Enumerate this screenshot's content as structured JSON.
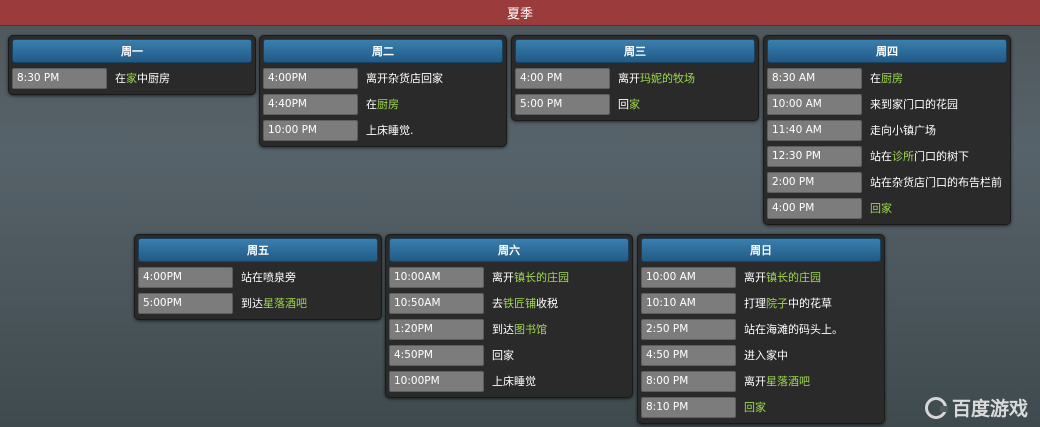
{
  "season": "夏季",
  "days": [
    {
      "title": "周一",
      "rows": [
        {
          "time": "8:30 PM",
          "parts": [
            {
              "t": "在"
            },
            {
              "t": "家",
              "g": true
            },
            {
              "t": "中厨房"
            }
          ]
        }
      ]
    },
    {
      "title": "周二",
      "rows": [
        {
          "time": "4:00PM",
          "parts": [
            {
              "t": "离开杂货店回家"
            }
          ]
        },
        {
          "time": "4:40PM",
          "parts": [
            {
              "t": "在"
            },
            {
              "t": "厨房",
              "g": true
            }
          ]
        },
        {
          "time": "10:00 PM",
          "parts": [
            {
              "t": "上床睡觉."
            }
          ]
        }
      ]
    },
    {
      "title": "周三",
      "rows": [
        {
          "time": "4:00 PM",
          "parts": [
            {
              "t": "离开"
            },
            {
              "t": "玛妮的牧场",
              "g": true
            }
          ]
        },
        {
          "time": "5:00 PM",
          "parts": [
            {
              "t": "回"
            },
            {
              "t": "家",
              "g": true
            }
          ]
        }
      ]
    },
    {
      "title": "周四",
      "rows": [
        {
          "time": "8:30 AM",
          "parts": [
            {
              "t": "在"
            },
            {
              "t": "厨房",
              "g": true
            }
          ]
        },
        {
          "time": "10:00 AM",
          "parts": [
            {
              "t": "来到家门口的花园"
            }
          ]
        },
        {
          "time": "11:40 AM",
          "parts": [
            {
              "t": "走向小镇广场"
            }
          ]
        },
        {
          "time": "12:30 PM",
          "parts": [
            {
              "t": "站在"
            },
            {
              "t": "诊所",
              "g": true
            },
            {
              "t": "门口的树下"
            }
          ]
        },
        {
          "time": "2:00 PM",
          "parts": [
            {
              "t": "站在杂货店门口的布告栏前"
            }
          ]
        },
        {
          "time": "4:00 PM",
          "parts": [
            {
              "t": "回家",
              "g": true
            }
          ]
        }
      ]
    },
    {
      "title": "周五",
      "rows": [
        {
          "time": "4:00PM",
          "parts": [
            {
              "t": "站在喷泉旁"
            }
          ]
        },
        {
          "time": "5:00PM",
          "parts": [
            {
              "t": "到达"
            },
            {
              "t": "星落酒吧",
              "g": true
            }
          ]
        }
      ]
    },
    {
      "title": "周六",
      "rows": [
        {
          "time": "10:00AM",
          "parts": [
            {
              "t": "离开"
            },
            {
              "t": "镇长的庄园",
              "g": true
            }
          ]
        },
        {
          "time": "10:50AM",
          "parts": [
            {
              "t": "去"
            },
            {
              "t": "铁匠铺",
              "g": true
            },
            {
              "t": "收税"
            }
          ]
        },
        {
          "time": "1:20PM",
          "parts": [
            {
              "t": "到达"
            },
            {
              "t": "图书馆",
              "g": true
            }
          ]
        },
        {
          "time": "4:50PM",
          "parts": [
            {
              "t": "回家"
            }
          ]
        },
        {
          "time": "10:00PM",
          "parts": [
            {
              "t": "上床睡觉"
            }
          ]
        }
      ]
    },
    {
      "title": "周日",
      "rows": [
        {
          "time": "10:00 AM",
          "parts": [
            {
              "t": "离开"
            },
            {
              "t": "镇长的庄园",
              "g": true
            }
          ]
        },
        {
          "time": "10:10 AM",
          "parts": [
            {
              "t": "打理"
            },
            {
              "t": "院子",
              "g": true
            },
            {
              "t": "中的花草"
            }
          ]
        },
        {
          "time": "2:50 PM",
          "parts": [
            {
              "t": "站在海滩的码头上。"
            }
          ]
        },
        {
          "time": "4:50 PM",
          "parts": [
            {
              "t": "进入家中"
            }
          ]
        },
        {
          "time": "8:00 PM",
          "parts": [
            {
              "t": "离开"
            },
            {
              "t": "星落酒吧",
              "g": true
            }
          ]
        },
        {
          "time": "8:10 PM",
          "parts": [
            {
              "t": "回家",
              "g": true
            }
          ]
        }
      ]
    }
  ],
  "watermark": "百度游戏",
  "colors": {
    "header": "#9c3b3b",
    "day_head": "#2c6d9c",
    "highlight": "#9dd84f",
    "time_cell": "#7c7c7c",
    "panel": "#2a2a2a"
  },
  "icons": {
    "watermark_logo": "baidu-game-logo-icon"
  }
}
